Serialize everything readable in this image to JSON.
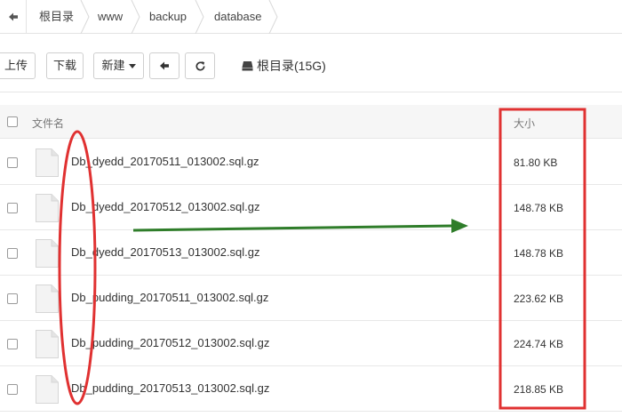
{
  "breadcrumb": {
    "items": [
      "根目录",
      "www",
      "backup",
      "database"
    ]
  },
  "toolbar": {
    "upload_label": "上传",
    "download_label": "下载",
    "new_label": "新建",
    "drive_label": "根目录(15G)"
  },
  "table": {
    "headers": {
      "name": "文件名",
      "size": "大小"
    },
    "rows": [
      {
        "name": "Db_dyedd_20170511_013002.sql.gz",
        "size": "81.80 KB"
      },
      {
        "name": "Db_dyedd_20170512_013002.sql.gz",
        "size": "148.78 KB"
      },
      {
        "name": "Db_dyedd_20170513_013002.sql.gz",
        "size": "148.78 KB"
      },
      {
        "name": "Db_pudding_20170511_013002.sql.gz",
        "size": "223.62 KB"
      },
      {
        "name": "Db_pudding_20170512_013002.sql.gz",
        "size": "224.74 KB"
      },
      {
        "name": "Db_pudding_20170513_013002.sql.gz",
        "size": "218.85 KB"
      }
    ]
  },
  "annotations": {
    "highlight_color": "#e03131",
    "arrow_color": "#2f7d2a"
  }
}
